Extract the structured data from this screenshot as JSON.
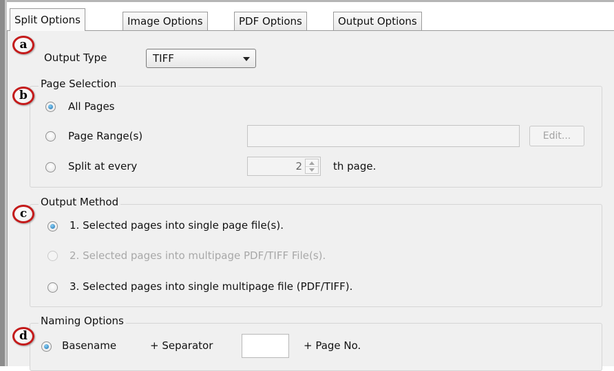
{
  "tabs": [
    {
      "label": "Split Options",
      "active": true
    },
    {
      "label": "Image Options",
      "active": false
    },
    {
      "label": "PDF Options",
      "active": false
    },
    {
      "label": "Output Options",
      "active": false
    }
  ],
  "callouts": [
    "a",
    "b",
    "c",
    "d"
  ],
  "output_type": {
    "label": "Output Type",
    "selected": "TIFF"
  },
  "page_selection": {
    "title": "Page Selection",
    "all_pages": "All Pages",
    "page_range": "Page Range(s)",
    "page_range_value": "",
    "edit_button": "Edit...",
    "split_every": "Split at every",
    "split_value": "2",
    "th_page": "th page."
  },
  "output_method": {
    "title": "Output Method",
    "option1": "1. Selected pages into single page file(s).",
    "option2": "2. Selected pages into multipage PDF/TIFF File(s).",
    "option3": "3. Selected pages into single multipage file (PDF/TIFF)."
  },
  "naming_options": {
    "title": "Naming Options",
    "basename": "Basename",
    "separator": "+ Separator",
    "separator_value": "",
    "page_no": "+ Page No."
  },
  "colors": {
    "callout_border": "#c41a1a",
    "radio_selected": "#1b6fb0",
    "panel_bg": "#f0f0f0"
  }
}
